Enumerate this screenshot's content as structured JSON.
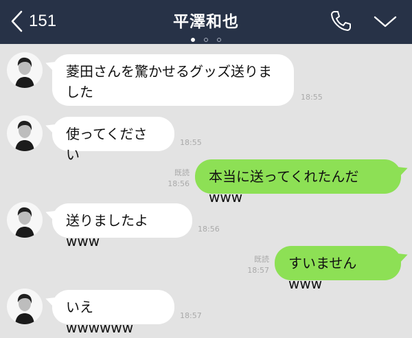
{
  "header": {
    "back_count": "151",
    "title": "平澤和也",
    "icons": {
      "back": "chevron-left-icon",
      "call": "phone-icon",
      "menu": "chevron-down-icon"
    }
  },
  "colors": {
    "header_bg": "#273247",
    "chat_bg": "#e3e3e3",
    "outgoing_bubble": "#8de055",
    "incoming_bubble": "#ffffff"
  },
  "messages": [
    {
      "direction": "in",
      "text": "菱田さんを驚かせるグッズ送りました",
      "time": "18:55"
    },
    {
      "direction": "in",
      "text": "使ってください",
      "time": "18:55"
    },
    {
      "direction": "out",
      "text": "本当に送ってくれたんだwww",
      "read": "既読",
      "time": "18:56"
    },
    {
      "direction": "in",
      "text": "送りましたよwww",
      "time": "18:56"
    },
    {
      "direction": "out",
      "text": "すいませんwww",
      "read": "既読",
      "time": "18:57"
    },
    {
      "direction": "in",
      "text": "いえwwwwww",
      "time": "18:57"
    }
  ]
}
